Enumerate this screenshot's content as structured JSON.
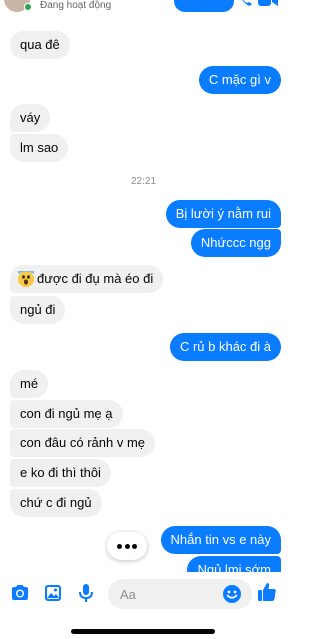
{
  "header": {
    "status": "Đang hoạt động"
  },
  "timestamp": "22:21",
  "messages": [
    {
      "text": "qua đê"
    },
    {
      "text": "C mặc gì v"
    },
    {
      "text": "váy"
    },
    {
      "text": "lm sao"
    },
    {
      "text": "Bị lười ý nằm rui"
    },
    {
      "text": "Nhứccc ngg"
    },
    {
      "text": "được đi đụ mà éo đi",
      "emoji": "scream-emoji"
    },
    {
      "text": "ngủ đi"
    },
    {
      "text": "C rủ b khác đi à"
    },
    {
      "text": "mé"
    },
    {
      "text": "con đi ngủ mẹ ạ"
    },
    {
      "text": "con đâu có rảnh v mẹ"
    },
    {
      "text": "e ko đi thì thôi"
    },
    {
      "text": "chứ c đi ngủ"
    },
    {
      "text": "Nhắn tin vs e này"
    },
    {
      "text": "Ngủ lmj sớm"
    }
  ],
  "composer": {
    "placeholder": "Aa"
  },
  "colors": {
    "accent": "#0a7cff",
    "incoming": "#f0f0f0",
    "online": "#31a24c"
  }
}
